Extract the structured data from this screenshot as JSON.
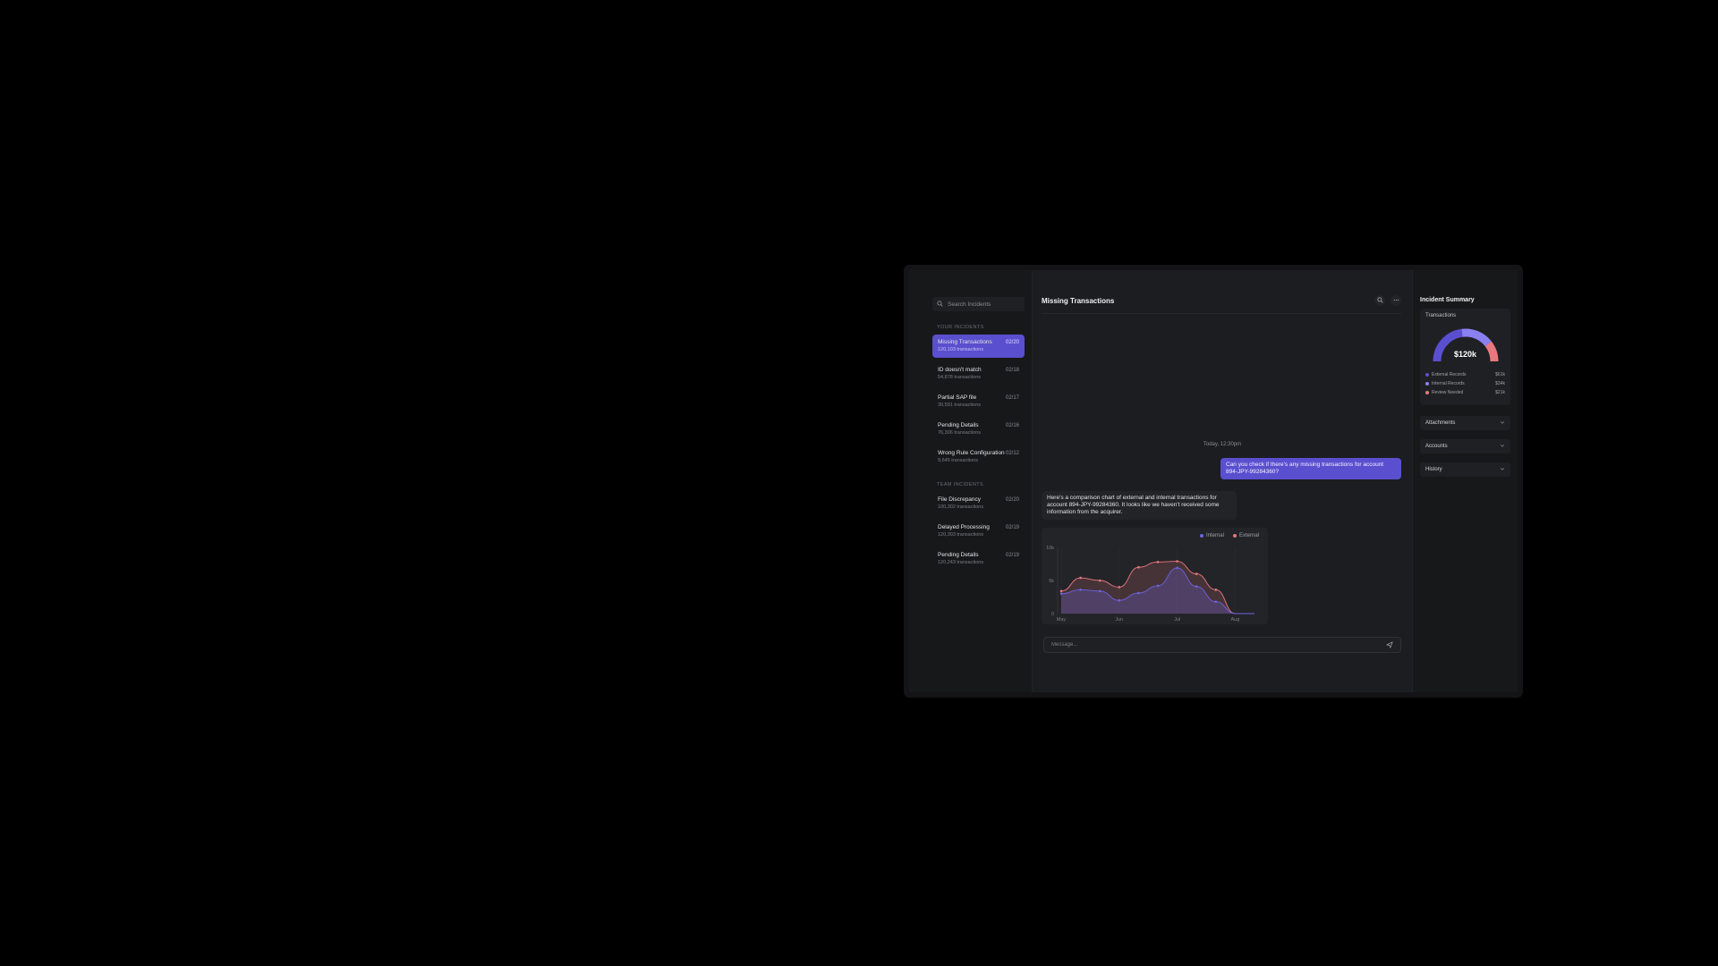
{
  "sidebar": {
    "search_placeholder": "Search Incidents",
    "your_section_label": "YOUR INCIDENTS",
    "team_section_label": "TEAM INCIDENTS",
    "your_incidents": [
      {
        "name": "Missing Transactions",
        "count": "120,103 transactions",
        "date": "02/20",
        "active": true
      },
      {
        "name": "ID doesn't match",
        "count": "54,878 transactions",
        "date": "02/18"
      },
      {
        "name": "Partial SAP file",
        "count": "30,591 transactions",
        "date": "02/17"
      },
      {
        "name": "Pending Details",
        "count": "76,306 transactions",
        "date": "02/16"
      },
      {
        "name": "Wrong Rule Configuration",
        "count": "9,645 transactions",
        "date": "02/12"
      }
    ],
    "team_incidents": [
      {
        "name": "File Discrepancy",
        "count": "100,302 transactions",
        "date": "02/20"
      },
      {
        "name": "Delayed Processing",
        "count": "120,303 transactions",
        "date": "02/19"
      },
      {
        "name": "Pending Details",
        "count": "120,243 transactions",
        "date": "02/19"
      }
    ]
  },
  "main": {
    "title": "Missing Transactions",
    "timestamp": "Today, 12:30pm",
    "user_message": "Can you check if there's any missing transactions for account 894-JPY-99284360?",
    "bot_message": "Here's a comparison chart of external and internal transactions for account 894-JPY-99284360. It looks like we haven't received some information from the acquirer.",
    "composer_placeholder": "Message..."
  },
  "chart_data": {
    "type": "area",
    "x": [
      0,
      1,
      2,
      3,
      4,
      5,
      6,
      7,
      8,
      9,
      10
    ],
    "x_tick_labels": [
      "May",
      "Jun",
      "Jul",
      "Aug"
    ],
    "x_tick_positions": [
      0,
      3,
      6,
      9
    ],
    "y_tick_labels": [
      "10k",
      "5k",
      "0"
    ],
    "ylim": [
      0,
      10000
    ],
    "series": [
      {
        "name": "Internal",
        "color": "#6d63e0",
        "values": [
          3000,
          3600,
          3400,
          2000,
          3100,
          4200,
          6900,
          4100,
          1800,
          0,
          0
        ]
      },
      {
        "name": "External",
        "color": "#e8787f",
        "values": [
          3400,
          5400,
          5000,
          4000,
          7000,
          7800,
          7900,
          6000,
          3600,
          0,
          0
        ]
      }
    ]
  },
  "summary": {
    "title": "Incident Summary",
    "transactions_label": "Transactions",
    "total": "$120k",
    "gauge_fractions": [
      0.46,
      0.33,
      0.21
    ],
    "breakdown": [
      {
        "label": "External Records",
        "value": "$61k",
        "color": "#5a4fcf"
      },
      {
        "label": "Internal Records",
        "value": "$34k",
        "color": "#8b80f0"
      },
      {
        "label": "Review Needed",
        "value": "$21k",
        "color": "#e8787f"
      }
    ],
    "accordions": [
      "Attachments",
      "Accounts",
      "History"
    ]
  }
}
